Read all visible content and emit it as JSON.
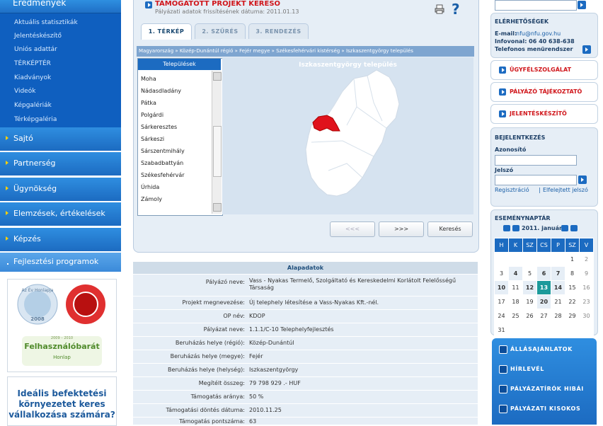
{
  "left_nav": {
    "top_item": "Eredmények",
    "sub_items": [
      "Aktuális statisztikák",
      "Jelentéskészítő",
      "Uniós adattár",
      "TÉRKÉPTÉR",
      "Kiadványok",
      "Videók",
      "Képgalériák",
      "Térképgaléria"
    ],
    "main_items": [
      "Sajtó",
      "Partnerség",
      "Ügynökség",
      "Elemzések, értékelések",
      "Képzés"
    ],
    "selected_item": "Fejlesztési programok",
    "badge_top": "Az Év Honlapja",
    "badge_year": "2008",
    "badge_bottom_title": "Felhasználóbarát",
    "badge_bottom_years": "2009 – 2010",
    "badge_bottom_sub": "Honlap",
    "ad_lines": [
      "Ideális befektetési",
      "környezetet keres",
      "vállalkozása számára?"
    ]
  },
  "header": {
    "title": "TÁMOGATOTT PROJEKT KERESŐ",
    "subtitle": "Pályázati adatok frissítésének dátuma: 2011.01.13",
    "help_symbol": "?"
  },
  "tabs": [
    "1. TÉRKÉP",
    "2. SZŰRÉS",
    "3. RENDEZÉS"
  ],
  "breadcrumb": "Magyarország » Közép-Dunántúl régió » Fejér megye » Székesfehérvári kistérség » Iszkaszentgyörgy település",
  "settlements": {
    "header": "Települések",
    "items": [
      "Moha",
      "Nádasdladány",
      "Pátka",
      "Polgárdi",
      "Sárkeresztes",
      "Sárkeszi",
      "Sárszentmihály",
      "Szabadbattyán",
      "Székesfehérvár",
      "Úrhida",
      "Zámoly"
    ]
  },
  "map": {
    "title": "Iszkaszentgyörgy település",
    "highlight_color": "#e0121c",
    "area_color": "#ffffff"
  },
  "search_buttons": {
    "prev": "<<<",
    "next": ">>>",
    "search": "Keresés"
  },
  "details": {
    "header": "Alapadatok",
    "rows": [
      {
        "k": "Pályázó neve:",
        "v": "Vass - Nyakas Termelő, Szolgáltató és Kereskedelmi Korlátolt Felelősségű Társaság"
      },
      {
        "k": "Projekt megnevezése:",
        "v": "Új telephely létesítése a Vass-Nyakas Kft.-nél."
      },
      {
        "k": "OP név:",
        "v": "KDOP"
      },
      {
        "k": "Pályázat neve:",
        "v": "1.1.1/C-10 Telephelyfejlesztés"
      },
      {
        "k": "Beruházás helye (régió):",
        "v": "Közép-Dunántúl"
      },
      {
        "k": "Beruházás helye (megye):",
        "v": "Fejér"
      },
      {
        "k": "Beruházás helye (helység):",
        "v": "Iszkaszentgyörgy"
      },
      {
        "k": "Megítélt összeg:",
        "v": "79 798 929 .- HUF"
      },
      {
        "k": "Támogatás aránya:",
        "v": "50 %"
      },
      {
        "k": "Támogatási döntés dátuma:",
        "v": "2010.11.25"
      },
      {
        "k": "Támogatás pontszáma:",
        "v": "63"
      }
    ]
  },
  "right": {
    "contact_title": "ELÉRHETŐSÉGEK",
    "email_label": "E-mail:",
    "email": "nfu@nfu.gov.hu",
    "infovonal": "Infovonal: 06 40 638-638",
    "phone_menu": "Telefonos menürendszer",
    "links": [
      "ÜGYFÉLSZOLGÁLAT",
      "PÁLYÁZÓ TÁJÉKOZTATÓ",
      "JELENTÉSKÉSZÍTŐ"
    ],
    "login_title": "BEJELENTKEZÉS",
    "user_label": "Azonosító",
    "pass_label": "Jelszó",
    "register": "Regisztráció",
    "forgot": "Elfelejtett jelszó",
    "separator": "|",
    "calendar_title": "ESEMÉNYNAPTÁR",
    "calendar_month": "2011. január",
    "weekdays": [
      "H",
      "K",
      "SZ",
      "CS",
      "P",
      "SZ",
      "V"
    ],
    "bottom_links": [
      "ÁLLÁSAJÁNLATOK",
      "HÍRLEVÉL",
      "PÁLYÁZATÍRÓK HIBÁI",
      "PÁLYÁZATI KISOKOS"
    ]
  }
}
